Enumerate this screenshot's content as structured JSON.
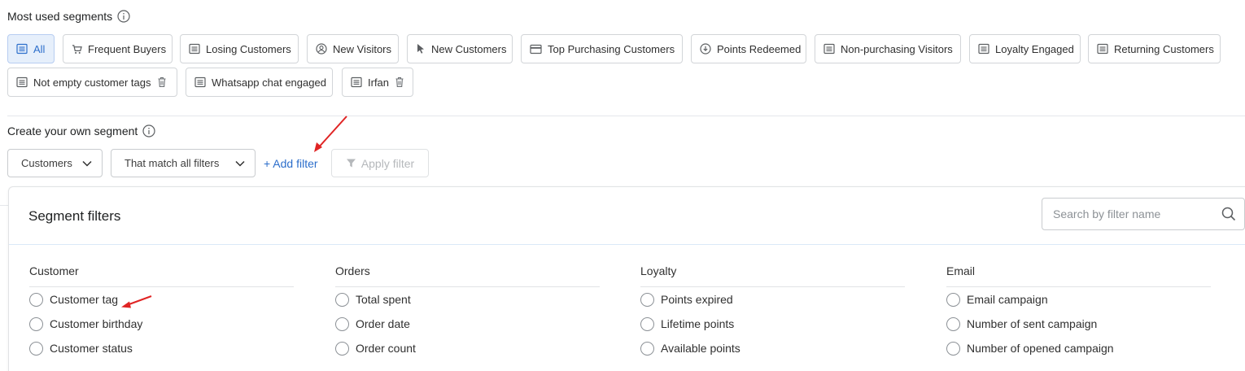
{
  "most_used": {
    "title": "Most used segments",
    "chips": [
      {
        "label": "All",
        "icon": "list-icon",
        "active": true
      },
      {
        "label": "Frequent Buyers",
        "icon": "cart-icon"
      },
      {
        "label": "Losing Customers",
        "icon": "list-icon"
      },
      {
        "label": "New Visitors",
        "icon": "user-circle-icon"
      },
      {
        "label": "New Customers",
        "icon": "cursor-icon"
      },
      {
        "label": "Top Purchasing Customers",
        "icon": "card-icon"
      },
      {
        "label": "Points Redeemed",
        "icon": "download-circle-icon"
      },
      {
        "label": "Non-purchasing Visitors",
        "icon": "list-icon"
      },
      {
        "label": "Loyalty Engaged",
        "icon": "list-icon"
      },
      {
        "label": "Returning Customers",
        "icon": "list-icon"
      },
      {
        "label": "Not empty customer tags",
        "icon": "list-icon",
        "deletable": true
      },
      {
        "label": "Whatsapp chat engaged",
        "icon": "list-icon"
      },
      {
        "label": "Irfan",
        "icon": "list-icon",
        "deletable": true
      }
    ]
  },
  "create": {
    "title": "Create your own segment",
    "entity_select": "Customers",
    "match_select": "That match all filters",
    "add_filter": "+ Add filter",
    "apply_filter": "Apply filter"
  },
  "panel": {
    "title": "Segment filters",
    "search_placeholder": "Search by filter name",
    "columns": [
      {
        "title": "Customer",
        "options": [
          "Customer tag",
          "Customer birthday",
          "Customer status"
        ]
      },
      {
        "title": "Orders",
        "options": [
          "Total spent",
          "Order date",
          "Order count"
        ]
      },
      {
        "title": "Loyalty",
        "options": [
          "Points expired",
          "Lifetime points",
          "Available points"
        ]
      },
      {
        "title": "Email",
        "options": [
          "Email campaign",
          "Number of sent campaign",
          "Number of opened campaign"
        ]
      }
    ]
  },
  "colors": {
    "accent": "#2c6ecb",
    "annotation": "#e02424",
    "active_chip_bg": "#e6effb"
  }
}
